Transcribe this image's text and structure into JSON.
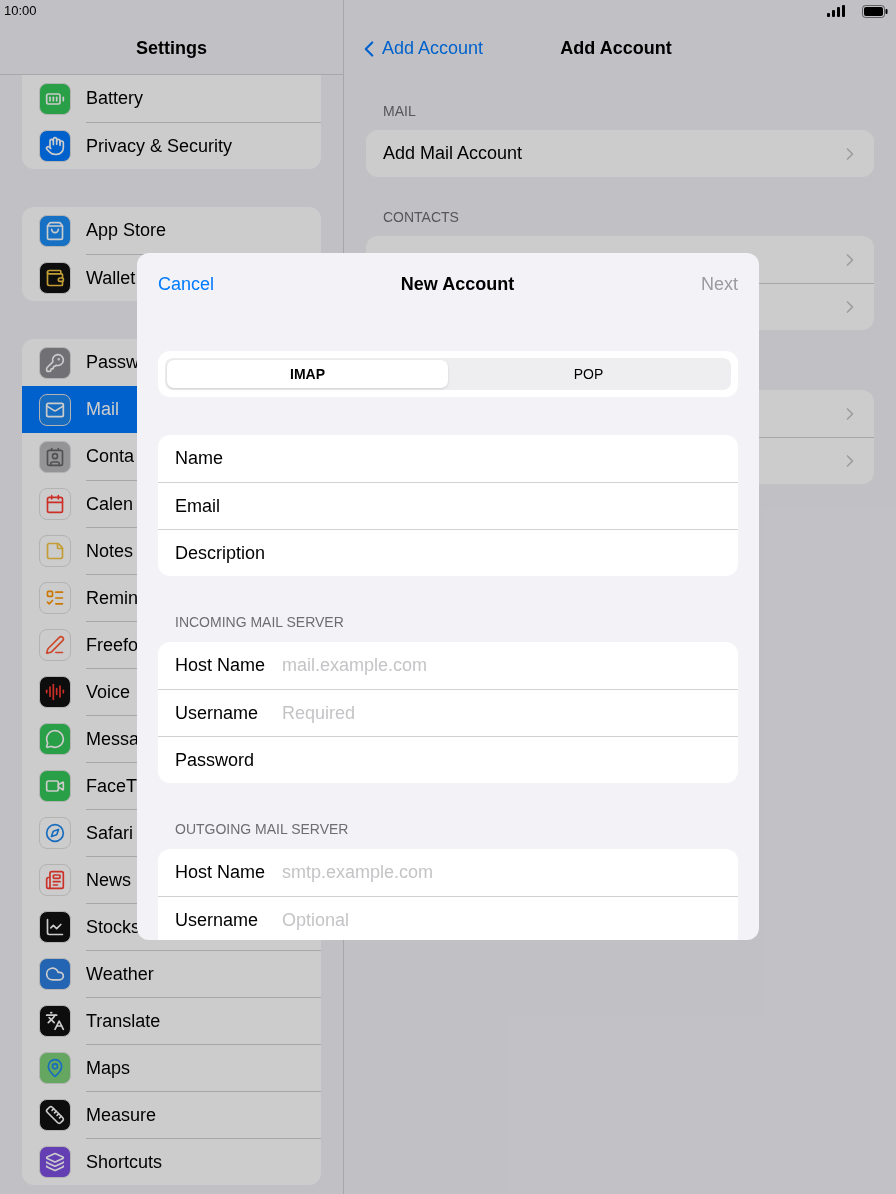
{
  "status_bar": {
    "time": "10:00"
  },
  "sidebar": {
    "title": "Settings",
    "groups": [
      {
        "items": [
          {
            "label": "Battery",
            "selected": false
          },
          {
            "label": "Privacy & Security",
            "selected": false
          }
        ]
      },
      {
        "items": [
          {
            "label": "App Store",
            "selected": false
          },
          {
            "label": "Wallet",
            "selected": false
          }
        ]
      },
      {
        "items": [
          {
            "label": "Passw",
            "selected": false
          },
          {
            "label": "Mail",
            "selected": true
          },
          {
            "label": "Conta",
            "selected": false
          },
          {
            "label": "Calen",
            "selected": false
          },
          {
            "label": "Notes",
            "selected": false
          },
          {
            "label": "Remin",
            "selected": false
          },
          {
            "label": "Freefo",
            "selected": false
          },
          {
            "label": "Voice",
            "selected": false
          },
          {
            "label": "Messa",
            "selected": false
          },
          {
            "label": "FaceT",
            "selected": false
          },
          {
            "label": "Safari",
            "selected": false
          },
          {
            "label": "News",
            "selected": false
          },
          {
            "label": "Stocks",
            "selected": false
          },
          {
            "label": "Weather",
            "selected": false
          },
          {
            "label": "Translate",
            "selected": false
          },
          {
            "label": "Maps",
            "selected": false
          },
          {
            "label": "Measure",
            "selected": false
          },
          {
            "label": "Shortcuts",
            "selected": false
          }
        ]
      }
    ]
  },
  "detail": {
    "back": "Add Account",
    "title": "Add Account",
    "sections": [
      {
        "header": "MAIL",
        "rows": [
          {
            "kind": "link",
            "label": "Add Mail Account"
          }
        ]
      },
      {
        "header": "CONTACTS",
        "rows": [
          {
            "kind": "link"
          },
          {
            "kind": "link"
          }
        ]
      },
      {
        "rows": [
          {
            "kind": "link"
          },
          {
            "kind": "link"
          }
        ]
      }
    ]
  },
  "modal": {
    "cancel": "Cancel",
    "title": "New Account",
    "next": "Next",
    "next_disabled": true,
    "segments": [
      {
        "label": "IMAP",
        "selected": true
      },
      {
        "label": "POP",
        "selected": false
      }
    ],
    "groups": [
      {
        "fields": [
          {
            "label": "Name"
          },
          {
            "label": "Email"
          },
          {
            "label": "Description"
          }
        ]
      },
      {
        "header": "INCOMING MAIL SERVER",
        "fields": [
          {
            "label": "Host Name",
            "placeholder": "mail.example.com"
          },
          {
            "label": "Username",
            "placeholder": "Required"
          },
          {
            "label": "Password"
          }
        ]
      },
      {
        "header": "OUTGOING MAIL SERVER",
        "fields": [
          {
            "label": "Host Name",
            "placeholder": "smtp.example.com"
          },
          {
            "label": "Username",
            "placeholder": "Optional"
          }
        ]
      }
    ]
  }
}
